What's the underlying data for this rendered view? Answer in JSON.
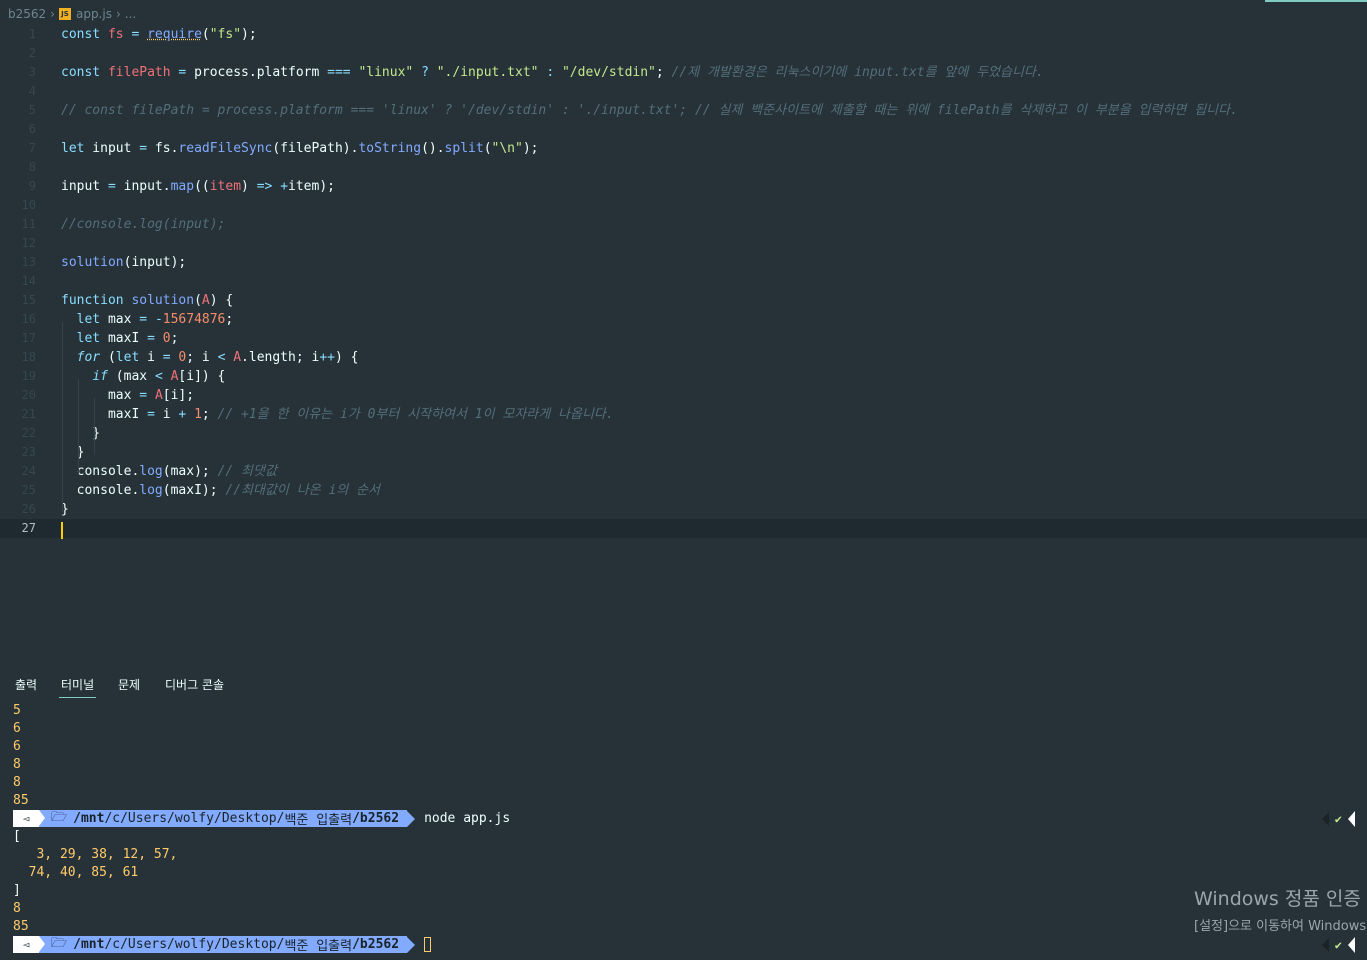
{
  "breadcrumb": {
    "folder": "b2562",
    "file": "app.js",
    "more": "...",
    "file_icon_text": "JS"
  },
  "editor": {
    "lines": [
      [
        [
          "kw",
          "const"
        ],
        [
          "pl",
          " "
        ],
        [
          "var",
          "fs"
        ],
        [
          "pl",
          " "
        ],
        [
          "op",
          "="
        ],
        [
          "pl",
          " "
        ],
        [
          "fnul",
          "require"
        ],
        [
          "pl",
          "("
        ],
        [
          "str",
          "\"fs\""
        ],
        [
          "pl",
          ");"
        ]
      ],
      [],
      [
        [
          "kw",
          "const"
        ],
        [
          "pl",
          " "
        ],
        [
          "var",
          "filePath"
        ],
        [
          "pl",
          " "
        ],
        [
          "op",
          "="
        ],
        [
          "pl",
          " process.platform "
        ],
        [
          "op",
          "==="
        ],
        [
          "pl",
          " "
        ],
        [
          "str",
          "\"linux\""
        ],
        [
          "pl",
          " "
        ],
        [
          "op",
          "?"
        ],
        [
          "pl",
          " "
        ],
        [
          "str",
          "\"./input.txt\""
        ],
        [
          "pl",
          " "
        ],
        [
          "op",
          ":"
        ],
        [
          "pl",
          " "
        ],
        [
          "str",
          "\"/dev/stdin\""
        ],
        [
          "pl",
          "; "
        ],
        [
          "cm",
          "//제 개발환경은 리눅스이기에 input.txt를 앞에 두었습니다."
        ]
      ],
      [],
      [
        [
          "cm",
          "// const filePath = process.platform === 'linux' ? '/dev/stdin' : './input.txt'; // 실제 백준사이트에 제출할 때는 위에 filePath를 삭제하고 이 부분을 입력하면 됩니다."
        ]
      ],
      [],
      [
        [
          "kw",
          "let"
        ],
        [
          "pl",
          " input "
        ],
        [
          "op",
          "="
        ],
        [
          "pl",
          " fs."
        ],
        [
          "fn",
          "readFileSync"
        ],
        [
          "pl",
          "(filePath)."
        ],
        [
          "fn",
          "toString"
        ],
        [
          "pl",
          "()."
        ],
        [
          "fn",
          "split"
        ],
        [
          "pl",
          "("
        ],
        [
          "str",
          "\"\\n\""
        ],
        [
          "pl",
          ");"
        ]
      ],
      [],
      [
        [
          "pl",
          "input "
        ],
        [
          "op",
          "="
        ],
        [
          "pl",
          " input."
        ],
        [
          "fn",
          "map"
        ],
        [
          "pl",
          "(("
        ],
        [
          "var",
          "item"
        ],
        [
          "pl",
          ") "
        ],
        [
          "op",
          "=>"
        ],
        [
          "pl",
          " "
        ],
        [
          "op",
          "+"
        ],
        [
          "pl",
          "item);"
        ]
      ],
      [],
      [
        [
          "cm",
          "//console.log(input);"
        ]
      ],
      [],
      [
        [
          "fn",
          "solution"
        ],
        [
          "pl",
          "(input);"
        ]
      ],
      [],
      [
        [
          "kw",
          "function"
        ],
        [
          "pl",
          " "
        ],
        [
          "fn",
          "solution"
        ],
        [
          "pl",
          "("
        ],
        [
          "var",
          "A"
        ],
        [
          "pl",
          ") {"
        ]
      ],
      [
        [
          "pl",
          "  "
        ],
        [
          "kw",
          "let"
        ],
        [
          "pl",
          " max "
        ],
        [
          "op",
          "="
        ],
        [
          "pl",
          " "
        ],
        [
          "op",
          "-"
        ],
        [
          "num",
          "15674876"
        ],
        [
          "pl",
          ";"
        ]
      ],
      [
        [
          "pl",
          "  "
        ],
        [
          "kw",
          "let"
        ],
        [
          "pl",
          " maxI "
        ],
        [
          "op",
          "="
        ],
        [
          "pl",
          " "
        ],
        [
          "num",
          "0"
        ],
        [
          "pl",
          ";"
        ]
      ],
      [
        [
          "pl",
          "  "
        ],
        [
          "kwi",
          "for"
        ],
        [
          "pl",
          " ("
        ],
        [
          "kw",
          "let"
        ],
        [
          "pl",
          " i "
        ],
        [
          "op",
          "="
        ],
        [
          "pl",
          " "
        ],
        [
          "num",
          "0"
        ],
        [
          "pl",
          "; i "
        ],
        [
          "op",
          "<"
        ],
        [
          "pl",
          " "
        ],
        [
          "var",
          "A"
        ],
        [
          "pl",
          ".length; i"
        ],
        [
          "op",
          "++"
        ],
        [
          "pl",
          ") {"
        ]
      ],
      [
        [
          "pl",
          "    "
        ],
        [
          "kwi",
          "if"
        ],
        [
          "pl",
          " (max "
        ],
        [
          "op",
          "<"
        ],
        [
          "pl",
          " "
        ],
        [
          "var",
          "A"
        ],
        [
          "pl",
          "[i]) {"
        ]
      ],
      [
        [
          "pl",
          "      max "
        ],
        [
          "op",
          "="
        ],
        [
          "pl",
          " "
        ],
        [
          "var",
          "A"
        ],
        [
          "pl",
          "[i];"
        ]
      ],
      [
        [
          "pl",
          "      maxI "
        ],
        [
          "op",
          "="
        ],
        [
          "pl",
          " i "
        ],
        [
          "op",
          "+"
        ],
        [
          "pl",
          " "
        ],
        [
          "num",
          "1"
        ],
        [
          "pl",
          "; "
        ],
        [
          "cm",
          "// +1을 한 이유는 i가 0부터 시작하여서 1이 모자라게 나옵니다."
        ]
      ],
      [
        [
          "pl",
          "    }"
        ]
      ],
      [
        [
          "pl",
          "  }"
        ]
      ],
      [
        [
          "pl",
          "  console."
        ],
        [
          "fn",
          "log"
        ],
        [
          "pl",
          "(max); "
        ],
        [
          "cm",
          "// 최댓값"
        ]
      ],
      [
        [
          "pl",
          "  console."
        ],
        [
          "fn",
          "log"
        ],
        [
          "pl",
          "(maxI); "
        ],
        [
          "cm",
          "//최대값이 나온 i의 순서"
        ]
      ],
      [
        [
          "pl",
          "}"
        ]
      ],
      []
    ],
    "active_line": 27
  },
  "panel": {
    "tabs": [
      "출력",
      "터미널",
      "문제",
      "디버그 콘솔"
    ],
    "active_tab": 1
  },
  "terminal": {
    "pre_output": [
      "5",
      "6",
      "6",
      "8",
      "8",
      "85"
    ],
    "prompt": {
      "icon": "◅",
      "folder_icon": "🗁",
      "path_prefix": "/mnt",
      "path_middle": "/c/Users/wolfy/Desktop/",
      "path_korean": "백준 입출력",
      "path_last": "/b2562",
      "command": "node app.js",
      "status_mark": "✔"
    },
    "array_output": [
      "[",
      "   3, 29, 38, 12, 57,",
      "  74, 40, 85, 61",
      "]"
    ],
    "result": [
      "8",
      "85"
    ]
  },
  "watermark": {
    "line1": "Windows 정품 인증",
    "line2": "[설정]으로 이동하여 Windows"
  },
  "colors": {
    "background": "#263238",
    "accent": "#80cbc4",
    "prompt_blue": "#82aaff",
    "terminal_yellow": "#ffcb6b"
  }
}
